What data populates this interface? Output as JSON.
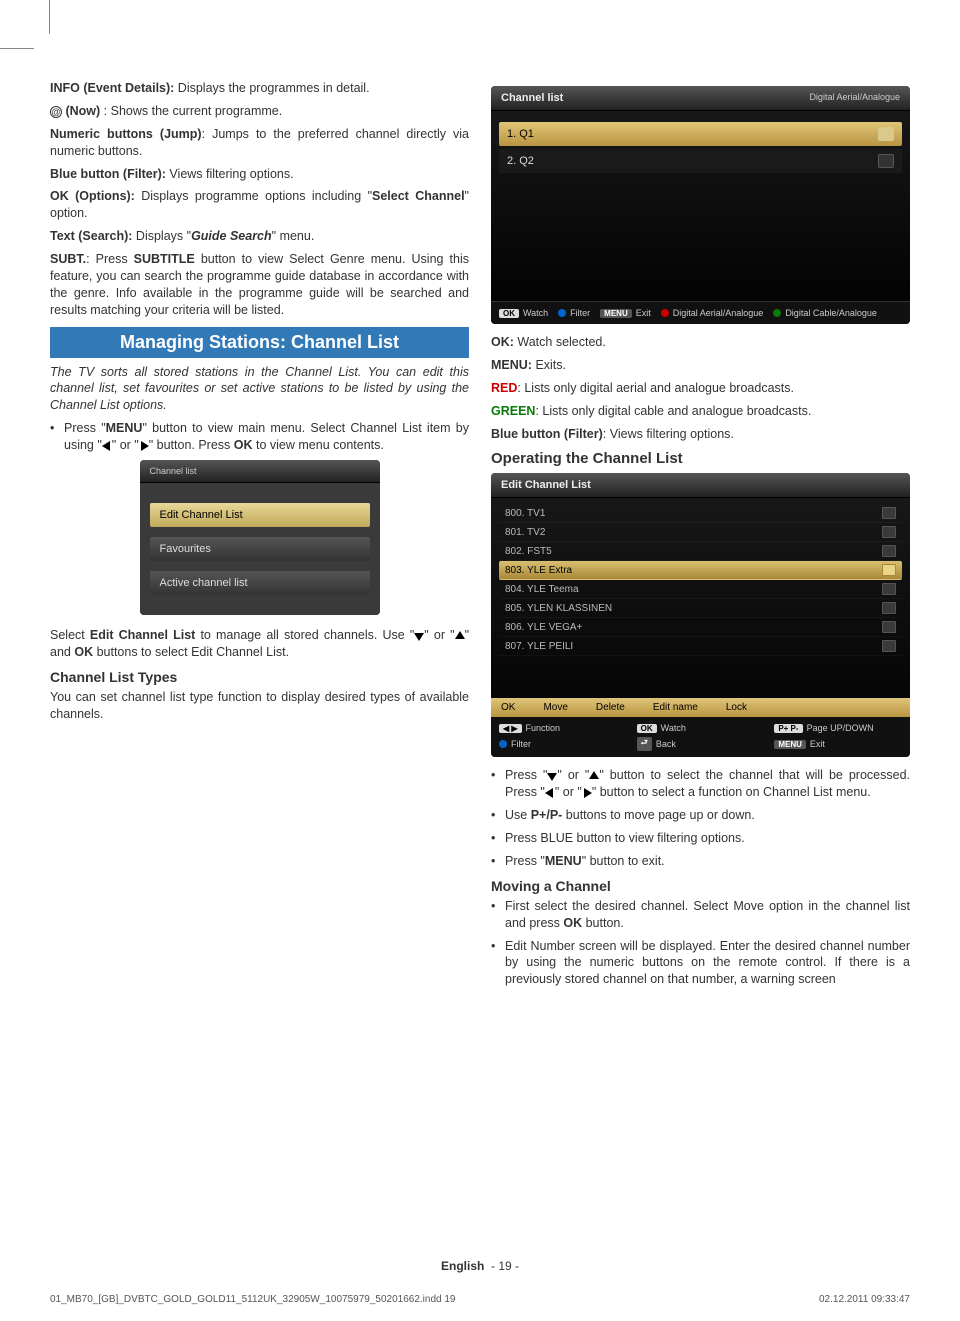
{
  "left": {
    "p1": {
      "b": "INFO (Event Details):",
      "t": " Displays the programmes in detail."
    },
    "p2": {
      "b": "(Now)",
      "t": " : Shows the current programme."
    },
    "p3": {
      "b": "Numeric buttons (Jump)",
      "t": ": Jumps to the preferred channel directly via numeric buttons."
    },
    "p4": {
      "b": "Blue button (Filter):",
      "t": " Views filtering options."
    },
    "p5": {
      "b": "OK (Options):",
      "t1": " Displays programme options including \"",
      "b2": "Select Channel",
      "t2": "\" option."
    },
    "p6": {
      "b": "Text (Search):",
      "t1": " Displays \"",
      "bi": "Guide Search",
      "t2": "\" menu."
    },
    "p7": {
      "b1": "SUBT.",
      "t1": ": Press  ",
      "b2": "SUBTITLE",
      "t2": "  button to view Select Genre menu. Using this feature, you can search the programme guide database in accordance with the genre. Info available in the programme guide will be searched and results matching your criteria will be listed."
    },
    "bar": "Managing Stations: Channel List",
    "p8": "The TV sorts all stored stations in the Channel List. You can edit this channel list, set favourites or set active stations to be listed by using the Channel List options.",
    "li1": {
      "t1": "Press \"",
      "b1": "MENU",
      "t2": "\" button to view main menu. Select Channel List item by using \"",
      "t3": "\" or \"",
      "t4": "\" button. Press ",
      "b2": "OK",
      "t5": " to view menu contents."
    },
    "menu": {
      "title": "Channel list",
      "items": [
        "Edit Channel List",
        "Favourites",
        "Active channel list"
      ]
    },
    "p9": {
      "t1": "Select ",
      "b": "Edit Channel List",
      "t2": " to manage all stored channels. Use \"",
      "t3": "\" or \"",
      "t4": "\" and ",
      "b2": "OK",
      "t5": " buttons to select Edit Channel List."
    },
    "sub1": "Channel List Types",
    "p10": "You can set channel list type function to display desired types of available channels."
  },
  "right": {
    "screen1": {
      "title": "Channel list",
      "subtitle": "Digital Aerial/Analogue",
      "rows": [
        {
          "label": "1. Q1",
          "hl": true
        },
        {
          "label": "2. Q2",
          "hl": false
        }
      ],
      "legend": {
        "ok": "Watch",
        "filter": "Filter",
        "menu": "Exit",
        "red": "Digital Aerial/Analogue",
        "green": "Digital Cable/Analogue"
      }
    },
    "d1": {
      "b": "OK:",
      "t": " Watch selected."
    },
    "d2": {
      "b": "MENU:",
      "t": " Exits."
    },
    "d3": {
      "b": "RED",
      "t": ": Lists only digital aerial and analogue broadcasts."
    },
    "d4": {
      "b": "GREEN",
      "t": ": Lists only digital cable and analogue broadcasts."
    },
    "d5": {
      "b": "Blue button (Filter)",
      "t": ": Views filtering options."
    },
    "sub2": "Operating the Channel List",
    "screen2": {
      "title": "Edit Channel List",
      "channels": [
        {
          "n": "800. TV1"
        },
        {
          "n": "801. TV2"
        },
        {
          "n": "802. FST5"
        },
        {
          "n": "803. YLE Extra",
          "hl": true
        },
        {
          "n": "804. YLE Teema"
        },
        {
          "n": "805. YLEN KLASSINEN"
        },
        {
          "n": "806. YLE VEGA+"
        },
        {
          "n": "807. YLE PEILI"
        }
      ],
      "footer": [
        "OK",
        "Move",
        "Delete",
        "Edit name",
        "Lock"
      ],
      "legend": {
        "func": "Function",
        "watch": "Watch",
        "page": "Page UP/DOWN",
        "filter": "Filter",
        "back": "Back",
        "exit": "Exit"
      }
    },
    "li2": {
      "t1": "Press \"",
      "t2": "\" or \"",
      "t3": "\" button to select the channel that will be processed. Press \"",
      "t4": "\" or \"",
      "t5": "\" button to select a function on Channel List menu."
    },
    "li3": {
      "t1": "Use ",
      "b": "P+/P-",
      "t2": " buttons to move page up or down."
    },
    "li4": "Press BLUE button to view filtering options.",
    "li5": {
      "t1": "Press \"",
      "b": "MENU",
      "t2": "\" button to exit."
    },
    "sub3": "Moving a Channel",
    "li6": {
      "t1": "First select the desired channel. Select Move option in the channel list and press ",
      "b": "OK",
      "t2": " button."
    },
    "li7": "Edit Number screen will be displayed. Enter the desired channel number by using the numeric buttons on the remote control. If there is a previously stored channel on that number, a warning screen"
  },
  "footer": {
    "lang": "English",
    "page": "- 19 -",
    "file": "01_MB70_[GB]_DVBTC_GOLD_GOLD11_5112UK_32905W_10075979_50201662.indd   19",
    "date": "02.12.2011   09:33:47"
  }
}
